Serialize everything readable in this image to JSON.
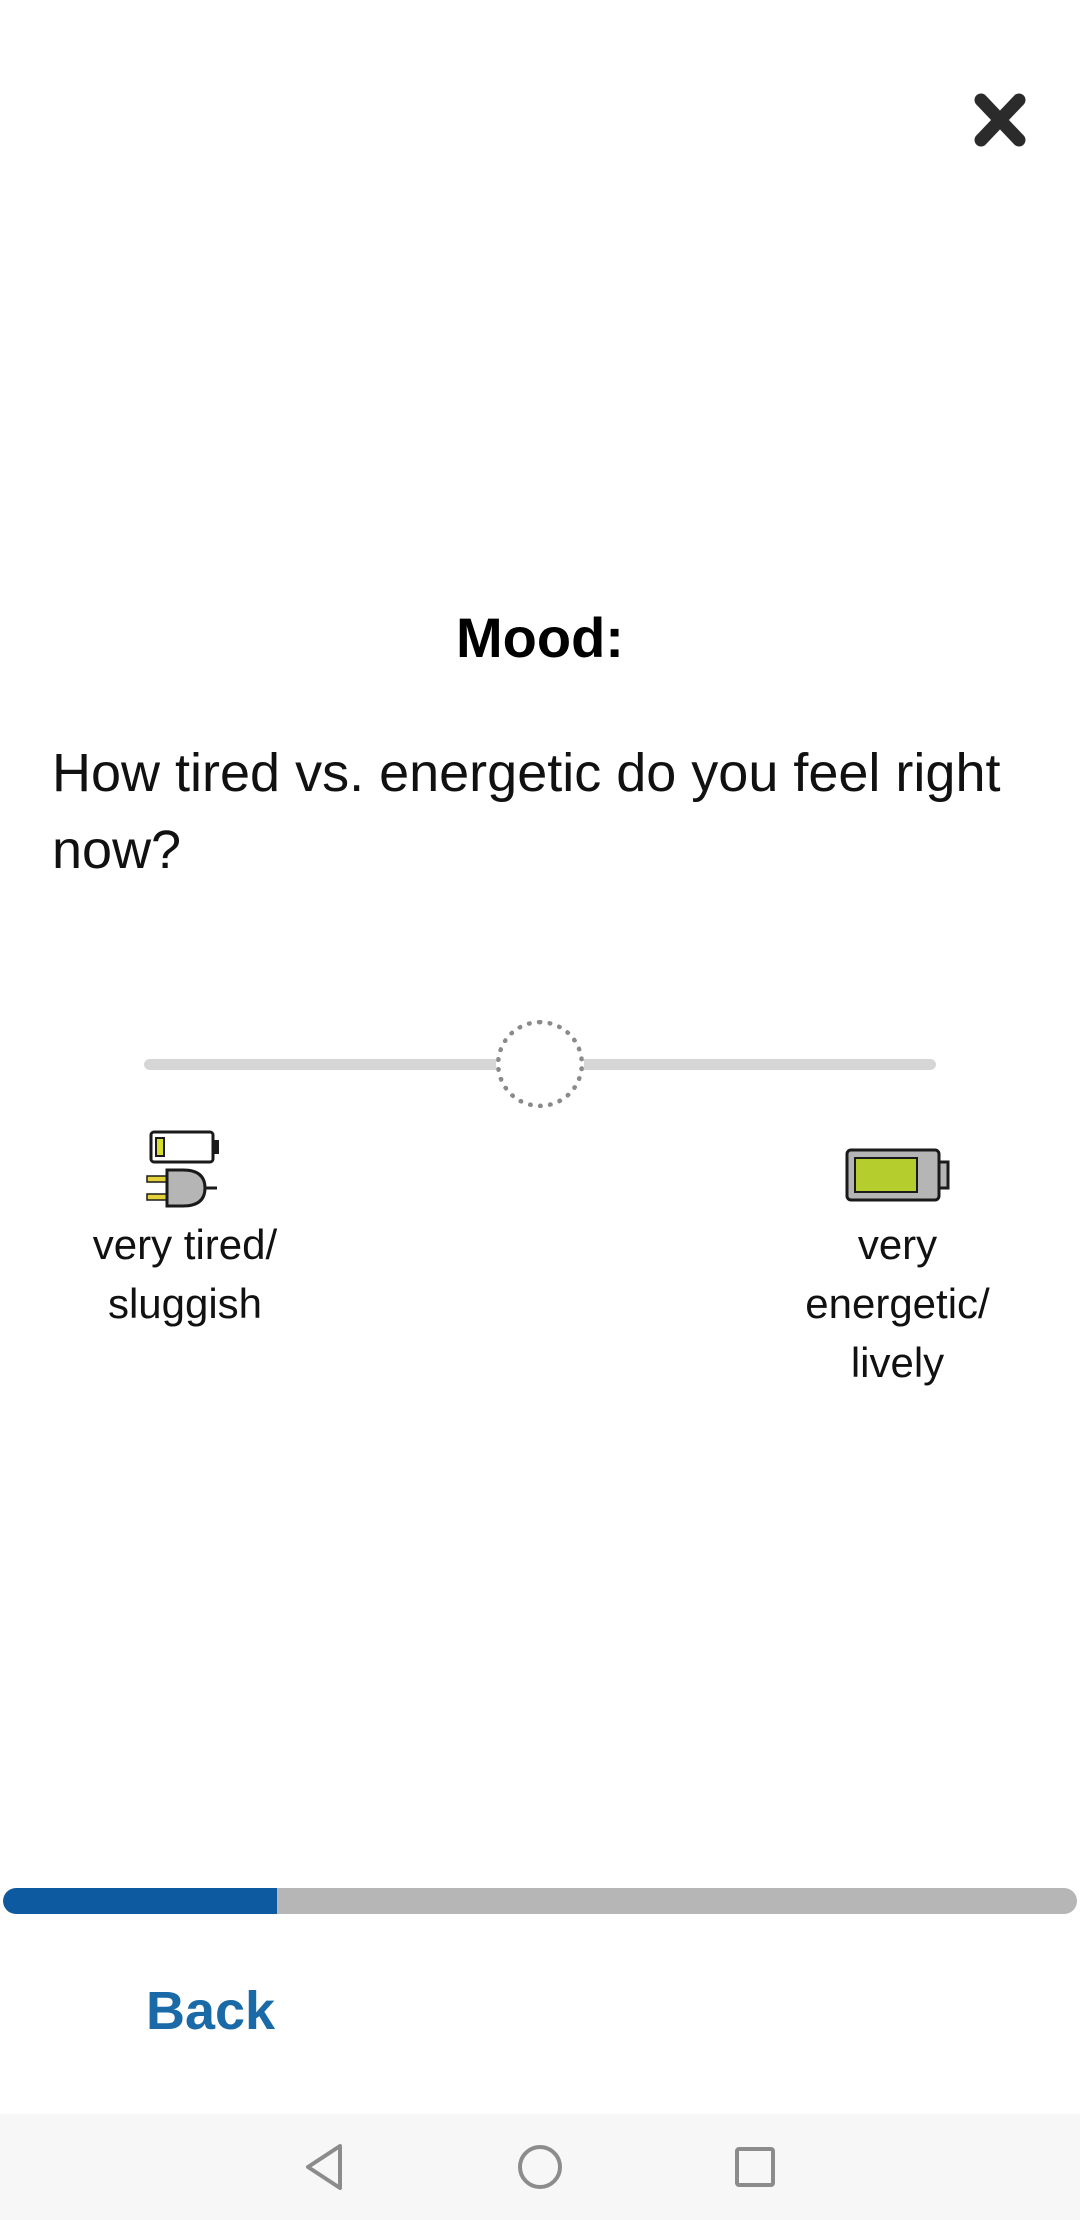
{
  "header": {
    "close_icon": "close-icon"
  },
  "section": {
    "title": "Mood:"
  },
  "question": {
    "text": "How tired vs. energetic do you feel right now?"
  },
  "slider": {
    "value_fraction": 0.5,
    "state": "unanswered",
    "min_label": "very tired/\nsluggish",
    "max_label": "very\nenergetic/\nlively",
    "min_icon": "low-battery-charging-icon",
    "max_icon": "full-battery-icon"
  },
  "progress": {
    "fraction": 0.255,
    "fill_color": "#0d5aa0",
    "track_color": "#b6b6b6"
  },
  "footer": {
    "back_label": "Back",
    "back_color": "#1a6aa8"
  },
  "system_nav": {
    "back_icon": "nav-back-icon",
    "home_icon": "nav-home-icon",
    "recents_icon": "nav-recents-icon"
  }
}
